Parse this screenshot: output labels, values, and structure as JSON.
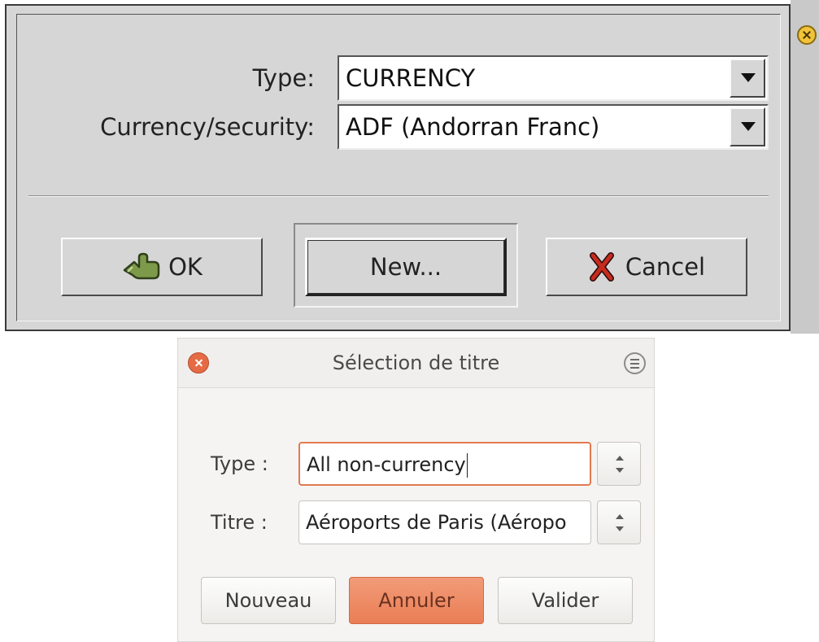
{
  "old_dialog": {
    "rows": [
      {
        "label": "Type:",
        "value": "CURRENCY"
      },
      {
        "label": "Currency/security:",
        "value": "ADF (Andorran Franc)"
      }
    ],
    "buttons": {
      "ok": "OK",
      "new": "New...",
      "cancel": "Cancel"
    }
  },
  "new_dialog": {
    "title": "Sélection de titre",
    "type_label": "Type :",
    "type_value": "All non-currency",
    "titre_label": "Titre :",
    "titre_value": "Aéroports de Paris (Aéropo",
    "buttons": {
      "nouveau": "Nouveau",
      "annuler": "Annuler",
      "valider": "Valider"
    }
  },
  "colors": {
    "focus_accent": "#e27a4f",
    "danger_button": "#ea7e55",
    "close_button": "#e56b45",
    "motif_gray": "#d6d6d6"
  }
}
